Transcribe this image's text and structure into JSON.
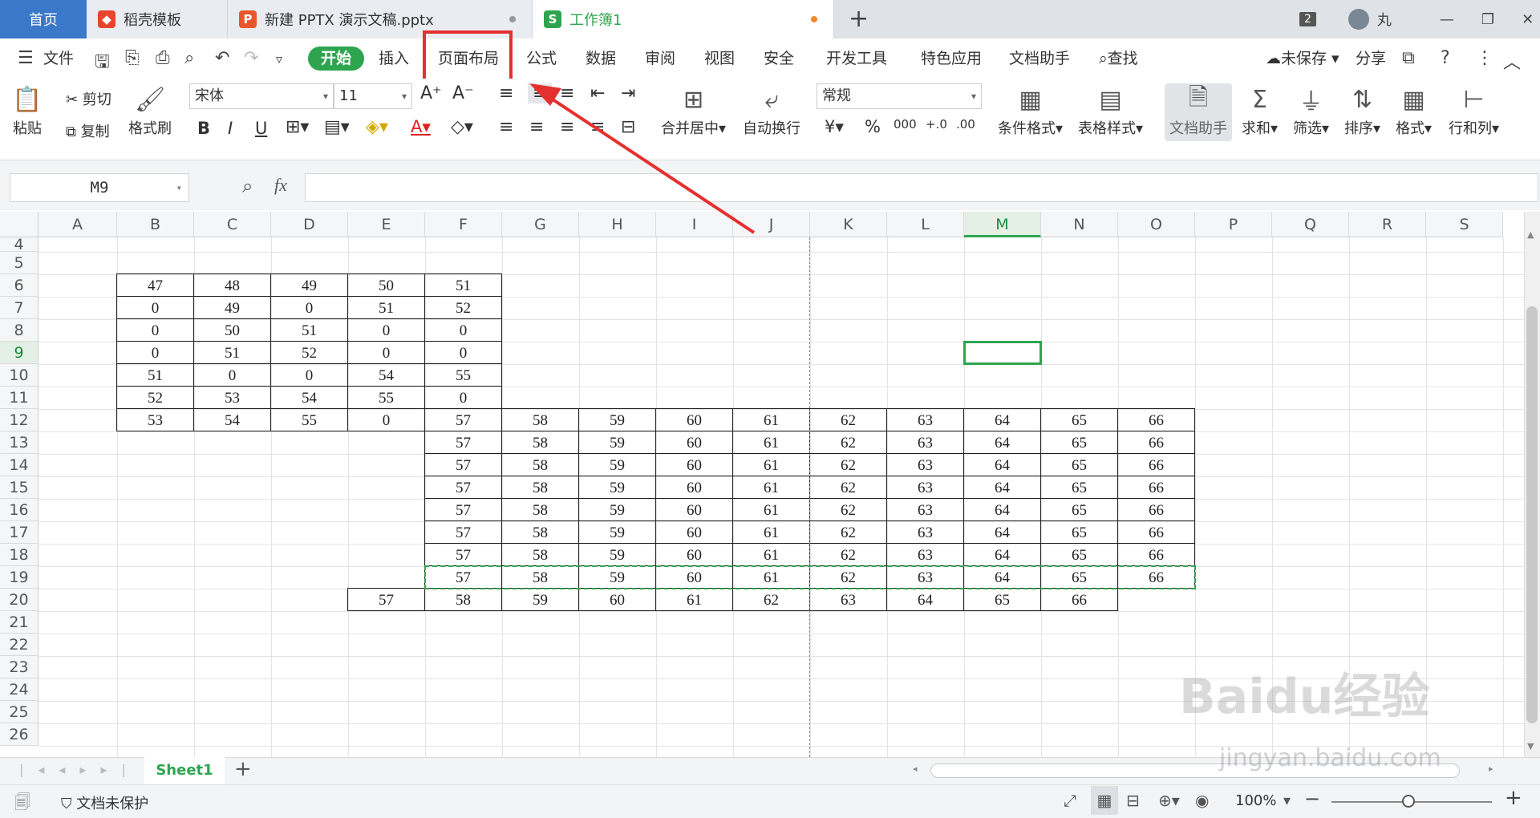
{
  "window": {
    "tabs": [
      {
        "label": "首页"
      },
      {
        "label": "稻壳模板",
        "icon": "docer-icon"
      },
      {
        "label": "新建 PPTX 演示文稿.pptx",
        "icon": "ppt-icon"
      },
      {
        "label": "工作簿1",
        "icon": "sheet-icon",
        "active": true
      }
    ],
    "new_tab": "+",
    "right": {
      "badge": "2",
      "user": "丸"
    }
  },
  "menu": {
    "file": "文件",
    "items": [
      "开始",
      "插入",
      "页面布局",
      "公式",
      "数据",
      "审阅",
      "视图",
      "安全",
      "开发工具",
      "特色应用",
      "文档助手"
    ],
    "search": "查找",
    "unsaved": "未保存",
    "share": "分享",
    "highlighted": "页面布局"
  },
  "ribbon": {
    "paste": "粘贴",
    "cut": "剪切",
    "copy": "复制",
    "format_painter": "格式刷",
    "font_name": "宋体",
    "font_size": "11",
    "merge_center": "合并居中",
    "wrap_text": "自动换行",
    "number_format": "常规",
    "conditional_format": "条件格式",
    "table_style": "表格样式",
    "doc_helper": "文档助手",
    "sum": "求和",
    "filter": "筛选",
    "sort": "排序",
    "format": "格式",
    "row_col": "行和列",
    "bold": "B",
    "italic": "I",
    "underline": "U",
    "font_color_letter": "A",
    "percent": "%"
  },
  "formula_bar": {
    "name_box": "M9",
    "fx": "fx",
    "value": ""
  },
  "columns": [
    "A",
    "B",
    "C",
    "D",
    "E",
    "F",
    "G",
    "H",
    "I",
    "J",
    "K",
    "L",
    "M",
    "N",
    "O",
    "P",
    "Q",
    "R",
    "S"
  ],
  "selected_column": "M",
  "rows": [
    "4",
    "5",
    "6",
    "7",
    "8",
    "9",
    "10",
    "11",
    "12",
    "13",
    "14",
    "15",
    "16",
    "17",
    "18",
    "19",
    "20",
    "21",
    "22",
    "23",
    "24",
    "25",
    "26"
  ],
  "selected_row": "9",
  "cells": {
    "r6": [
      "47",
      "48",
      "49",
      "50",
      "51"
    ],
    "r7": [
      "0",
      "49",
      "0",
      "51",
      "52"
    ],
    "r8": [
      "0",
      "50",
      "51",
      "0",
      "0"
    ],
    "r9": [
      "0",
      "51",
      "52",
      "0",
      "0"
    ],
    "r10": [
      "51",
      "0",
      "0",
      "54",
      "55"
    ],
    "r11": [
      "52",
      "53",
      "54",
      "55",
      "0"
    ],
    "r12": [
      "53",
      "54",
      "55",
      "0",
      "57",
      "58",
      "59",
      "60",
      "61",
      "62",
      "63",
      "64",
      "65",
      "66"
    ],
    "r13_19": [
      "57",
      "58",
      "59",
      "60",
      "61",
      "62",
      "63",
      "64",
      "65",
      "66"
    ],
    "r20": [
      "57",
      "58",
      "59",
      "60",
      "61",
      "62",
      "63",
      "64",
      "65",
      "66"
    ]
  },
  "sheets": {
    "active": "Sheet1",
    "add": "+"
  },
  "status": {
    "protect": "文档未保护",
    "zoom": "100%"
  },
  "watermark": {
    "brand": "Baidu经验",
    "url": "jingyan.baidu.com"
  },
  "colors": {
    "accent": "#2ea44f",
    "highlight": "#e53030",
    "home_tab": "#3a78c9"
  }
}
